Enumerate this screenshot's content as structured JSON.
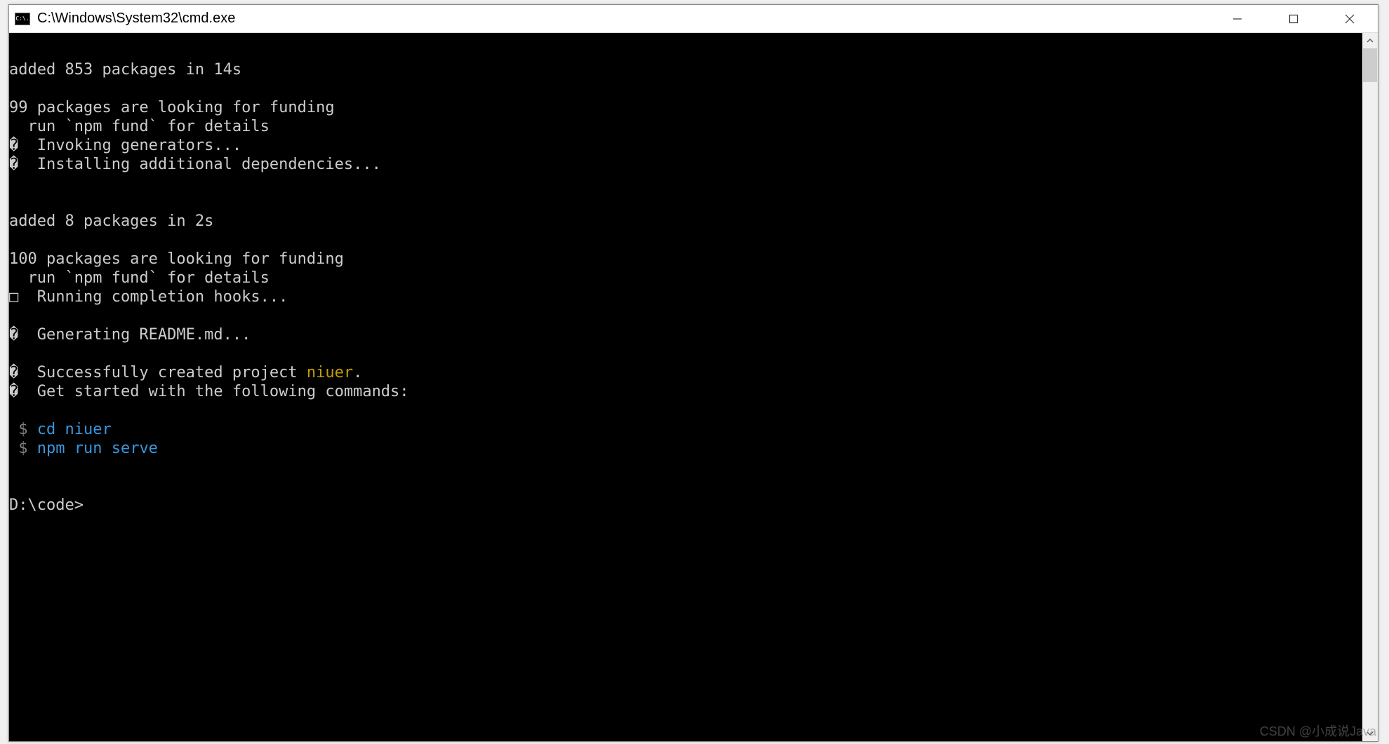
{
  "window": {
    "title": "C:\\Windows\\System32\\cmd.exe",
    "icon_label": "C:\\."
  },
  "terminal": {
    "line_blank1": "",
    "line_added1": "added 853 packages in 14s",
    "line_blank2": "",
    "line_funding1": "99 packages are looking for funding",
    "line_fund_hint1": "  run `npm fund` for details",
    "line_invoke_glyph": "�",
    "line_invoke_text": "  Invoking generators...",
    "line_install_glyph": "�",
    "line_install_text": "  Installing additional dependencies...",
    "line_blank3": "",
    "line_blank4": "",
    "line_added2": "added 8 packages in 2s",
    "line_blank5": "",
    "line_funding2": "100 packages are looking for funding",
    "line_fund_hint2": "  run `npm fund` for details",
    "line_hooks_glyph": "□",
    "line_hooks_text": "  Running completion hooks...",
    "line_blank6": "",
    "line_readme_glyph": "�",
    "line_readme_text": "  Generating README.md...",
    "line_blank7": "",
    "line_success_glyph": "�",
    "line_success_text1": "  Successfully created project ",
    "line_success_project": "niuer",
    "line_success_text2": ".",
    "line_getstarted_glyph": "�",
    "line_getstarted_text": "  Get started with the following commands:",
    "line_blank8": "",
    "line_cmd1_prompt": " $",
    "line_cmd1_cmd": " cd niuer",
    "line_cmd2_prompt": " $",
    "line_cmd2_cmd": " npm run serve",
    "line_blank9": "",
    "line_blank10": "",
    "line_prompt": "D:\\code>"
  },
  "watermark": "CSDN @小成说Java"
}
